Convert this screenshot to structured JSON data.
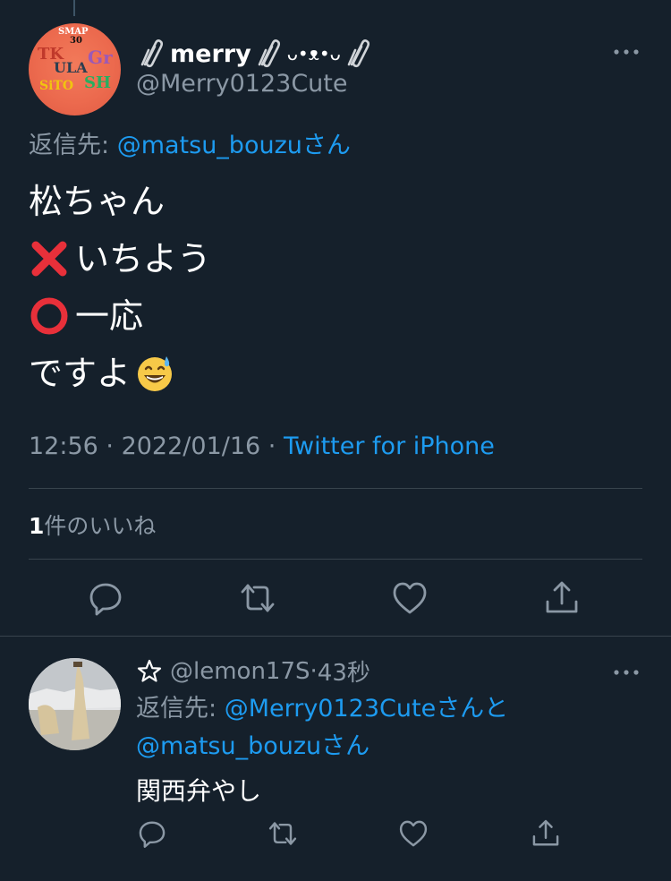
{
  "main_tweet": {
    "display_name": "merry",
    "display_name_face": "ᴗ•ᴥ•ᴗ",
    "handle": "@Merry0123Cute",
    "reply_to_prefix": "返信先: ",
    "reply_to_user": "@matsu_bouzu",
    "reply_to_suffix": "さん",
    "body_lines": [
      "松ちゃん",
      "いちよう",
      "一応",
      "ですよ"
    ],
    "time": "12:56",
    "date": "2022/01/16",
    "source": "Twitter for iPhone",
    "like_count": "1",
    "like_label": "件のいいね",
    "avatar_text": [
      "SMAP",
      "30"
    ]
  },
  "reply_tweet": {
    "handle": "@lemon17S",
    "time_ago": "43秒",
    "reply_to_prefix": "返信先: ",
    "reply_to_user1": "@Merry0123Cute",
    "reply_to_mid": "さんと",
    "reply_to_user2": "@matsu_bouzu",
    "reply_to_suffix": "さん",
    "body": "関西弁やし"
  },
  "actions": [
    "reply",
    "retweet",
    "like",
    "share"
  ],
  "colors": {
    "background": "#15202b",
    "text": "#ffffff",
    "secondary": "#8b98a5",
    "link": "#1d9bf0",
    "divider": "#38444d"
  }
}
